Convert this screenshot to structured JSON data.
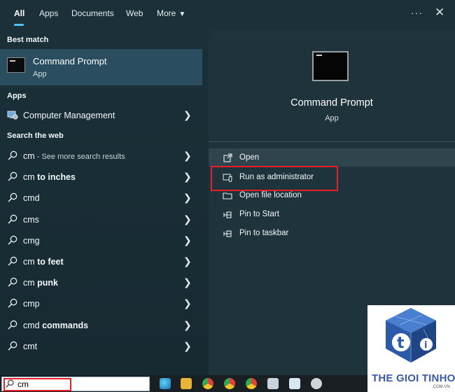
{
  "tabs": [
    {
      "label": "All",
      "active": true
    },
    {
      "label": "Apps"
    },
    {
      "label": "Documents"
    },
    {
      "label": "Web"
    },
    {
      "label": "More"
    }
  ],
  "best_match": {
    "header": "Best match",
    "title": "Command Prompt",
    "subtitle": "App"
  },
  "apps": {
    "header": "Apps",
    "items": [
      {
        "label": "Computer Management"
      }
    ]
  },
  "web": {
    "header": "Search the web",
    "first": {
      "query": "cm",
      "suffix": " - See more search results"
    },
    "items": [
      {
        "prefix": "cm ",
        "bold": "to inches"
      },
      {
        "prefix": "cmd",
        "bold": ""
      },
      {
        "prefix": "cms",
        "bold": ""
      },
      {
        "prefix": "cmg",
        "bold": ""
      },
      {
        "prefix": "cm ",
        "bold": "to feet"
      },
      {
        "prefix": "cm ",
        "bold": "punk"
      },
      {
        "prefix": "cmp",
        "bold": ""
      },
      {
        "prefix": "cmd ",
        "bold": "commands"
      },
      {
        "prefix": "cmt",
        "bold": ""
      }
    ]
  },
  "preview": {
    "title": "Command Prompt",
    "subtitle": "App",
    "actions": [
      {
        "label": "Open",
        "icon": "open-icon"
      },
      {
        "label": "Run as administrator",
        "icon": "shield-icon"
      },
      {
        "label": "Open file location",
        "icon": "folder-icon"
      },
      {
        "label": "Pin to Start",
        "icon": "pin-icon"
      },
      {
        "label": "Pin to taskbar",
        "icon": "pin-icon"
      }
    ]
  },
  "taskbar": {
    "search_value": "cm"
  },
  "watermark": {
    "brand": "THE GIOI TINHOC",
    "domain": ".COM.VN"
  },
  "colors": {
    "accent": "#4cc2ff",
    "highlight": "#e8202a",
    "selected_row": "#2a4e60"
  }
}
